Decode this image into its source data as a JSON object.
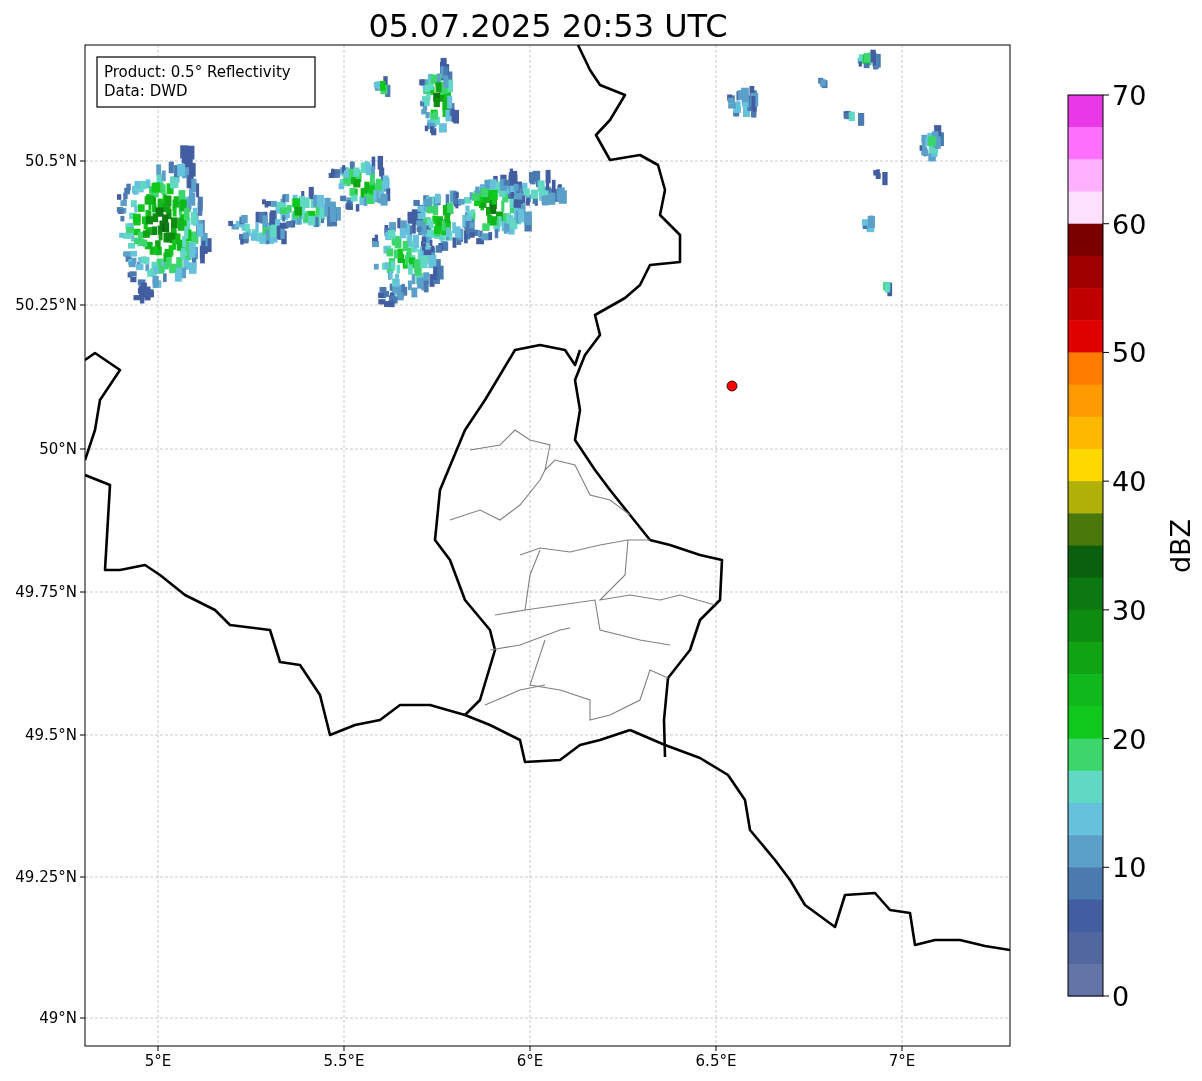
{
  "title": "05.07.2025 20:53 UTC",
  "info_box": [
    "Product: 0.5° Reflectivity",
    "Data: DWD"
  ],
  "map": {
    "x_ticks": [
      "5°E",
      "5.5°E",
      "6°E",
      "6.5°E",
      "7°E"
    ],
    "y_ticks": [
      "50.5°N",
      "50.25°N",
      "50°N",
      "49.75°N",
      "49.5°N",
      "49.25°N",
      "49°N"
    ]
  },
  "colorbar": {
    "label": "dBZ",
    "ticks": [
      "70",
      "60",
      "50",
      "40",
      "30",
      "20",
      "10",
      "0"
    ],
    "bands": [
      {
        "color": "#e838e8"
      },
      {
        "color": "#ff70ff"
      },
      {
        "color": "#ffb0ff"
      },
      {
        "color": "#ffe0ff"
      },
      {
        "color": "#7a0000"
      },
      {
        "color": "#a00000"
      },
      {
        "color": "#c00000"
      },
      {
        "color": "#e00000"
      },
      {
        "color": "#ff7c00"
      },
      {
        "color": "#ff9a00"
      },
      {
        "color": "#ffb800"
      },
      {
        "color": "#ffd800"
      },
      {
        "color": "#b0b008"
      },
      {
        "color": "#4a780a"
      },
      {
        "color": "#0a600e"
      },
      {
        "color": "#0c7812"
      },
      {
        "color": "#0e8c12"
      },
      {
        "color": "#10a414"
      },
      {
        "color": "#10b81c"
      },
      {
        "color": "#10c81c"
      },
      {
        "color": "#3cd66c"
      },
      {
        "color": "#60d8c4"
      },
      {
        "color": "#66c2dc"
      },
      {
        "color": "#5aa0c8"
      },
      {
        "color": "#4a7ab0"
      },
      {
        "color": "#425da0"
      },
      {
        "color": "#52679e"
      },
      {
        "color": "#6474a6"
      }
    ]
  }
}
